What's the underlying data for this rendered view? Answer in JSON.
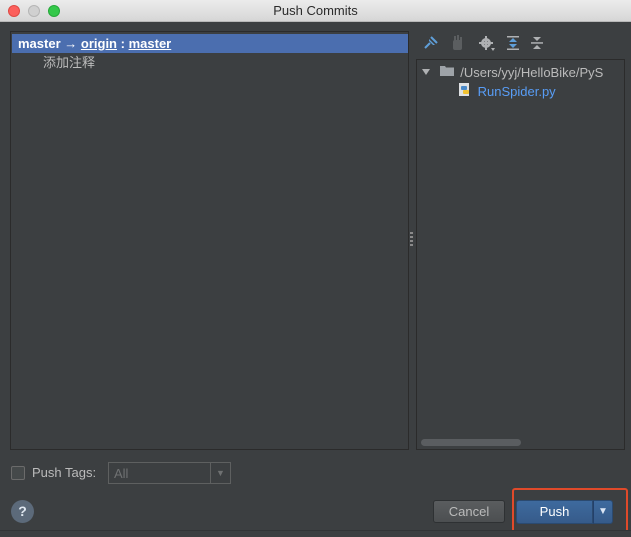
{
  "window": {
    "title": "Push Commits"
  },
  "commits_panel": {
    "local_branch": "master",
    "arrow": "→",
    "remote": "origin",
    "separator": ":",
    "remote_branch": "master",
    "commit_message": "添加注释"
  },
  "toolbar": {
    "icons": [
      "pin-icon",
      "hand-icon",
      "gear-icon",
      "expand-all-icon",
      "collapse-all-icon"
    ]
  },
  "files_panel": {
    "folder_path": "/Users/yyj/HelloBike/PyS",
    "file_name": "RunSpider.py"
  },
  "footer": {
    "push_tags_label": "Push Tags:",
    "push_tags_checked": false,
    "tags_value": "All",
    "help_label": "?",
    "cancel_label": "Cancel",
    "push_label": "Push"
  },
  "colors": {
    "background": "#3c3f41",
    "selection": "#4b6eaf",
    "file_link": "#589df6",
    "push_button": "#3e6a9e",
    "highlight": "#e04a2a"
  }
}
